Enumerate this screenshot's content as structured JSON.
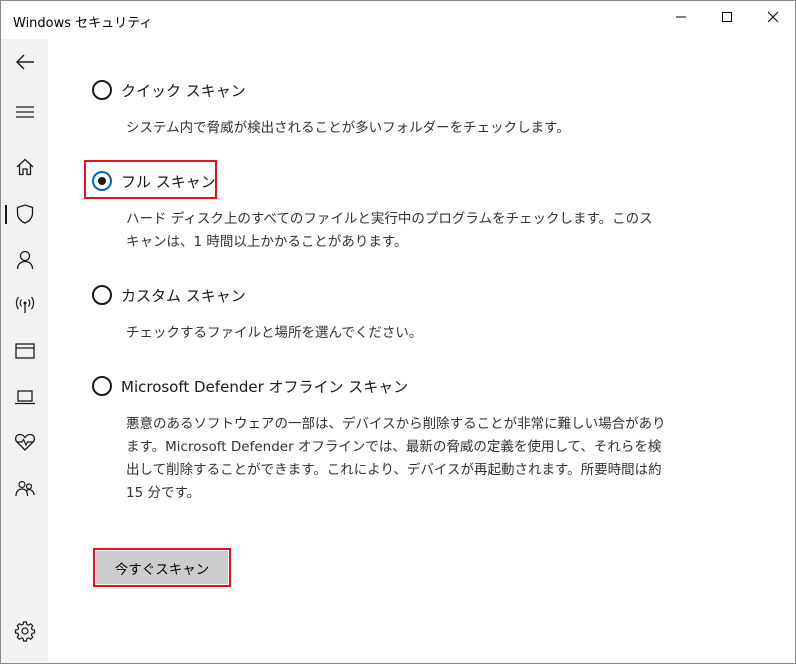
{
  "window": {
    "title": "Windows セキュリティ"
  },
  "sidebar": {
    "items": [
      {
        "icon": "back-arrow-icon"
      },
      {
        "icon": "hamburger-menu-icon"
      },
      {
        "icon": "home-icon"
      },
      {
        "icon": "shield-icon",
        "active": true
      },
      {
        "icon": "person-icon"
      },
      {
        "icon": "wireless-antenna-icon"
      },
      {
        "icon": "app-browser-window-icon"
      },
      {
        "icon": "laptop-icon"
      },
      {
        "icon": "heart-pulse-icon"
      },
      {
        "icon": "family-icon"
      },
      {
        "icon": "gear-icon"
      }
    ]
  },
  "scan_options": [
    {
      "label": "クイック スキャン",
      "selected": false,
      "description": "システム内で脅威が検出されることが多いフォルダーをチェックします。"
    },
    {
      "label": "フル スキャン",
      "selected": true,
      "description": "ハード ディスク上のすべてのファイルと実行中のプログラムをチェックします。このスキャンは、1 時間以上かかることがあります。"
    },
    {
      "label": "カスタム スキャン",
      "selected": false,
      "description": "チェックするファイルと場所を選んでください。"
    },
    {
      "label": "Microsoft Defender オフライン スキャン",
      "selected": false,
      "description": "悪意のあるソフトウェアの一部は、デバイスから削除することが非常に難しい場合があります。Microsoft Defender オフラインでは、最新の脅威の定義を使用して、それらを検出して削除することができます。これにより、デバイスが再起動されます。所要時間は約 15 分です。"
    }
  ],
  "scan_button": {
    "label": "今すぐスキャン"
  },
  "colors": {
    "highlight": "#e3141e",
    "radio_selected_ring": "#0067c0",
    "sidebar_bg": "#f2f2f2",
    "button_bg": "#cccccc"
  }
}
